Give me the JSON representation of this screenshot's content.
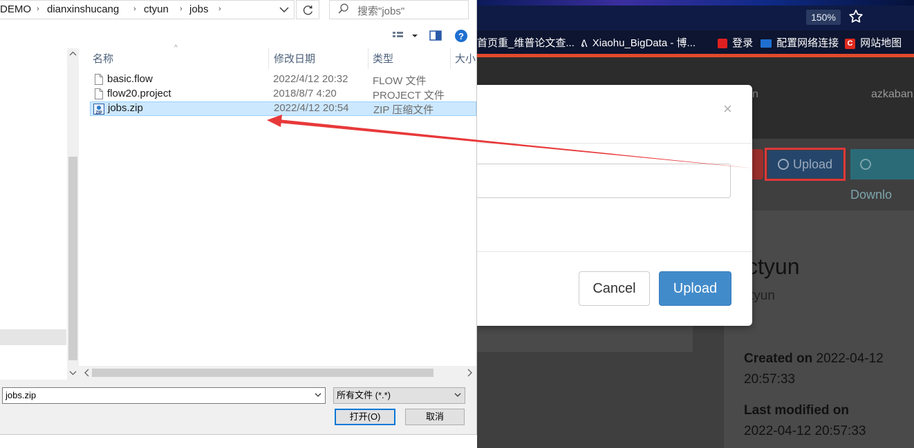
{
  "browser": {
    "zoom": "150%",
    "bookmarks": [
      {
        "label": "首页重_维普论文查..."
      },
      {
        "label": "Xiaohu_BigData - 博..."
      },
      {
        "label": "登录"
      },
      {
        "label": "配置网络连接"
      },
      {
        "label": "网站地图"
      }
    ]
  },
  "azkaban": {
    "nav_items": [
      "n",
      "azkaban"
    ],
    "buttons": {
      "upload": "Upload",
      "download": "Downlo"
    },
    "project_title": "ctyun",
    "project_subtitle": "tyun",
    "created_label": "Created on",
    "created_value": "2022-04-12",
    "created_time": "20:57:33",
    "modified_label": "Last modified on",
    "modified_value": "2022-04-12 20:57:33"
  },
  "modal": {
    "close": "×",
    "cancel": "Cancel",
    "upload": "Upload"
  },
  "file_dialog": {
    "breadcrumb": [
      "DEMO",
      "dianxinshucang",
      "ctyun",
      "jobs"
    ],
    "search_placeholder": "搜索\"jobs\"",
    "columns": {
      "name": "名称",
      "date": "修改日期",
      "type": "类型",
      "size": "大小"
    },
    "files": [
      {
        "name": "basic.flow",
        "date": "2022/4/12 20:32",
        "type": "FLOW 文件",
        "icon": "file-icon"
      },
      {
        "name": "flow20.project",
        "date": "2018/8/7 4:20",
        "type": "PROJECT 文件",
        "icon": "file-icon"
      },
      {
        "name": "jobs.zip",
        "date": "2022/4/12 20:54",
        "type": "ZIP 压缩文件",
        "icon": "zip-icon",
        "selected": true
      }
    ],
    "filename_value": "jobs.zip",
    "filter_value": "所有文件 (*.*)",
    "open_button": "打开(O)",
    "cancel_button": "取消"
  },
  "colors": {
    "annotation_red": "#e8393a",
    "primary_blue": "#428bca",
    "selection_blue": "#cce8ff"
  }
}
